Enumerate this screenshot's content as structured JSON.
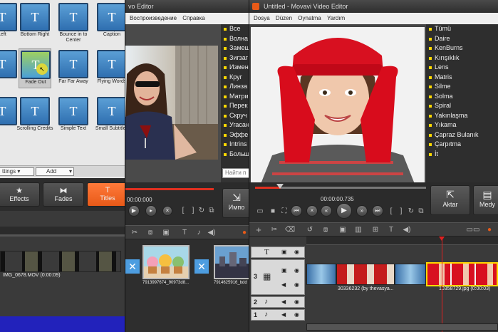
{
  "panel1": {
    "tiles": [
      {
        "label": "Left"
      },
      {
        "label": "Bottom Right"
      },
      {
        "label": "Bounce in to Center"
      },
      {
        "label": "Caption"
      },
      {
        "label": ""
      },
      {
        "label": "Fade Out"
      },
      {
        "label": "Far Far Away"
      },
      {
        "label": "Flying Words"
      },
      {
        "label": ""
      },
      {
        "label": "Scrolling Credits"
      },
      {
        "label": "Simple Text"
      },
      {
        "label": "Small Subtitles"
      }
    ],
    "tile_glyph": "T",
    "settings_dropdown": "ttings",
    "add_dropdown": "Add",
    "effects_label": "Effects",
    "fades_label": "Fades",
    "titles_label": "Titles",
    "clip_name": "IMG_0678.MOV (0:00:09)"
  },
  "panel2": {
    "title": "vo Editor",
    "menu": [
      "Воспроизведение",
      "Справка"
    ],
    "effects": [
      "Все",
      "Волна",
      "Замещ",
      "Зигзаг",
      "Измен",
      "Круг",
      "Линза",
      "Матри",
      "Перек",
      "Скруч",
      "Угасан",
      "Эффе",
      "Intrins",
      "Больш"
    ],
    "search_placeholder": "Найти п",
    "time": "00:00:000",
    "import_label": "Импо",
    "clip1_label": "7913997674_90973d8...",
    "clip2_label": "7914625916_bdd"
  },
  "panel3": {
    "title": "Untitled - Movavi Video Editor",
    "menu": [
      "Dosya",
      "Düzen",
      "Oynatma",
      "Yardım"
    ],
    "effects": [
      "Tümü",
      "Daire",
      "KenBurns",
      "Kırışıklık",
      "Lens",
      "Matris",
      "Silme",
      "Solma",
      "Spiral",
      "Yakınlaşma",
      "Yıkama",
      "Çapraz Bulanık",
      "Çarpıtma",
      "İt"
    ],
    "time": "00:00:00.735",
    "export_label": "Aktar",
    "media_label": "Medy",
    "track_numbers": [
      "3",
      "2",
      "1"
    ],
    "clip1_label": "30336232 (by thevasya...",
    "clip2_label": "10358729.jpg (0:00:03)"
  },
  "colors": {
    "accent": "#e85a18",
    "highlight": "#ffd800",
    "playhead": "#e02020"
  }
}
